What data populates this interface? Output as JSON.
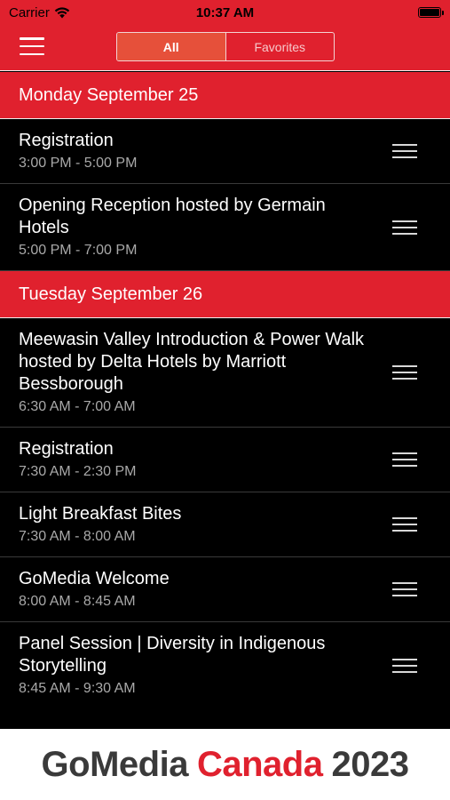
{
  "status_bar": {
    "carrier": "Carrier",
    "time": "10:37 AM"
  },
  "nav": {
    "segments": [
      {
        "label": "All",
        "active": true
      },
      {
        "label": "Favorites",
        "active": false
      }
    ]
  },
  "sections": [
    {
      "header": "Monday September 25",
      "items": [
        {
          "title": "Registration",
          "time": "3:00 PM - 5:00 PM"
        },
        {
          "title": "Opening Reception hosted by Germain Hotels",
          "time": "5:00 PM - 7:00 PM"
        }
      ]
    },
    {
      "header": "Tuesday September 26",
      "items": [
        {
          "title": "Meewasin Valley Introduction & Power Walk hosted by Delta Hotels by Marriott Bessborough",
          "time": "6:30 AM - 7:00 AM"
        },
        {
          "title": "Registration",
          "time": "7:30 AM - 2:30 PM"
        },
        {
          "title": "Light Breakfast Bites",
          "time": "7:30 AM - 8:00 AM"
        },
        {
          "title": "GoMedia Welcome",
          "time": "8:00 AM - 8:45 AM"
        },
        {
          "title": "Panel Session | Diversity in Indigenous Storytelling",
          "time": "8:45 AM - 9:30 AM"
        }
      ]
    }
  ],
  "footer": {
    "word1": "GoMedia",
    "word2": "Canada",
    "word3": "2023"
  },
  "colors": {
    "brand_red": "#e0212e",
    "background": "#000000",
    "footer_bg": "#ffffff"
  }
}
